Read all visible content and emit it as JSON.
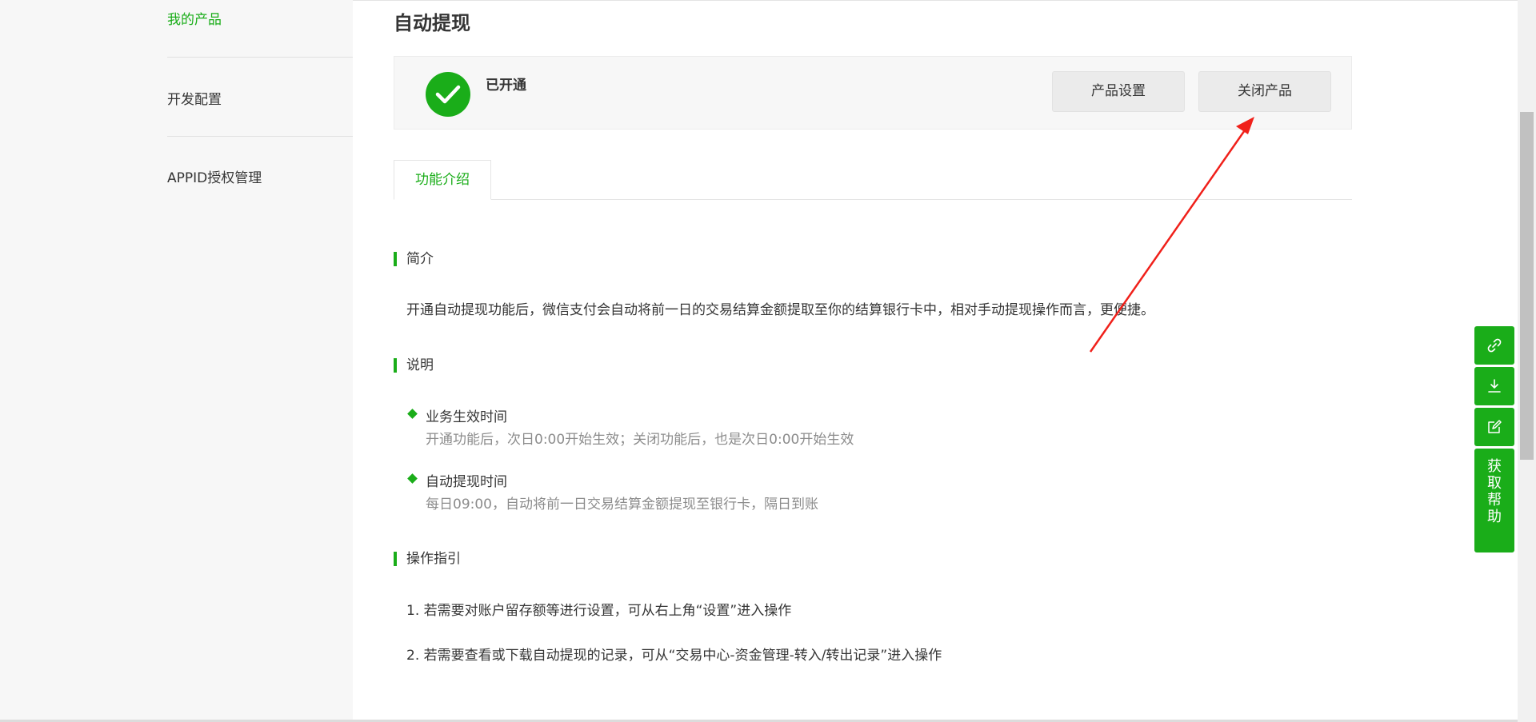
{
  "sidebar": {
    "items": [
      {
        "label": "我的产品"
      },
      {
        "label": "开发配置"
      },
      {
        "label": "APPID授权管理"
      }
    ]
  },
  "page": {
    "title": "自动提现"
  },
  "status": {
    "text": "已开通",
    "settings_button": "产品设置",
    "close_button": "关闭产品"
  },
  "tabs": [
    {
      "label": "功能介绍"
    }
  ],
  "sections": {
    "intro": {
      "title": "简介",
      "text": "开通自动提现功能后，微信支付会自动将前一日的交易结算金额提取至你的结算银行卡中，相对手动提现操作而言，更便捷。"
    },
    "notes": {
      "title": "说明",
      "items": [
        {
          "title": "业务生效时间",
          "desc": "开通功能后，次日0:00开始生效；关闭功能后，也是次日0:00开始生效"
        },
        {
          "title": "自动提现时间",
          "desc": "每日09:00，自动将前一日交易结算金额提现至银行卡，隔日到账"
        }
      ]
    },
    "guide": {
      "title": "操作指引",
      "steps": [
        "1. 若需要对账户留存额等进行设置，可从右上角“设置”进入操作",
        "2. 若需要查看或下载自动提现的记录，可从“交易中心-资金管理-转入/转出记录”进入操作"
      ]
    }
  },
  "float_bar": {
    "help_chars": [
      "获",
      "取",
      "帮",
      "助"
    ]
  },
  "colors": {
    "accent": "#1aad19",
    "annotation_arrow": "#f0201a"
  }
}
